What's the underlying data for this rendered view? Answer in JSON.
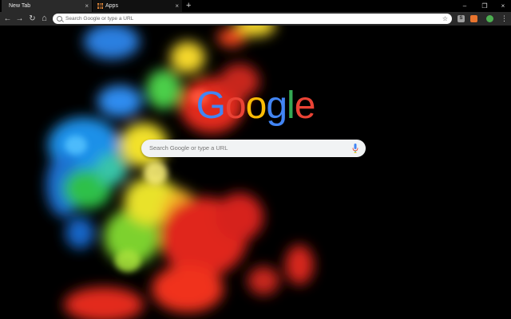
{
  "tabs": [
    {
      "title": "New Tab",
      "active": true,
      "close_glyph": "×"
    },
    {
      "title": "Apps",
      "active": false,
      "close_glyph": "×",
      "icon": "apps-grid-icon"
    }
  ],
  "new_tab_glyph": "+",
  "window_controls": {
    "minimize": "–",
    "restore": "❐",
    "close": "×"
  },
  "toolbar": {
    "back_glyph": "←",
    "forward_glyph": "→",
    "reload_glyph": "↻",
    "home_glyph": "⌂",
    "omnibox_placeholder": "Search Google or type a URL",
    "star_glyph": "☆",
    "menu_glyph": "⋮",
    "extensions": [
      {
        "name": "s-extension-icon",
        "glyph": "S",
        "color": "#9e9e9e"
      },
      {
        "name": "feed-extension-icon",
        "glyph": "",
        "color": "#e8742e"
      },
      {
        "name": "profile-extension-icon",
        "glyph": "",
        "color": "#4caf50"
      }
    ]
  },
  "logo": {
    "letters": [
      {
        "char": "G",
        "color": "#4285F4"
      },
      {
        "char": "o",
        "color": "#EA4335"
      },
      {
        "char": "o",
        "color": "#FBBC05"
      },
      {
        "char": "g",
        "color": "#4285F4"
      },
      {
        "char": "l",
        "color": "#34A853"
      },
      {
        "char": "e",
        "color": "#EA4335"
      }
    ]
  },
  "ntp_search": {
    "placeholder": "Search Google or type a URL"
  },
  "colors": {
    "frame": "#000000",
    "toolbar": "#2a2a2a",
    "active_tab": "#2a2a2a"
  }
}
